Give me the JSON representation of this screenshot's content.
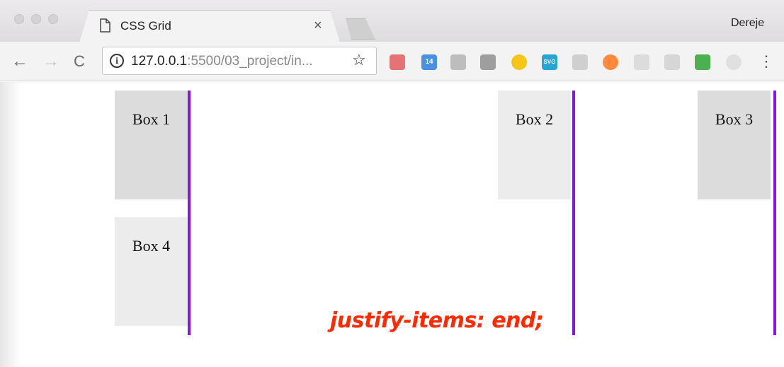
{
  "window": {
    "tab_title": "CSS Grid",
    "tab_close": "×",
    "profile_name": "Dereje"
  },
  "toolbar": {
    "back": "←",
    "forward": "→",
    "reload": "C",
    "url_host": "127.0.0.1",
    "url_rest": ":5500/03_project/in...",
    "bookmark_star": "☆",
    "menu": "⋮",
    "extensions": [
      {
        "name": "book-icon",
        "color": "#e57373"
      },
      {
        "name": "calendar-14-icon",
        "color": "#4a90e2",
        "label": "14"
      },
      {
        "name": "json-viewer-icon",
        "color": "#bdbdbd"
      },
      {
        "name": "braces-icon",
        "color": "#9e9e9e"
      },
      {
        "name": "moon-icon",
        "color": "#f5c518"
      },
      {
        "name": "svg-icon",
        "color": "#2aa4d5",
        "label": "SVG"
      },
      {
        "name": "pen-icon",
        "color": "#cfcfcf"
      },
      {
        "name": "lifebuoy-icon",
        "color": "#ff8a3d"
      },
      {
        "name": "leaf-icon",
        "color": "#dcdcdc"
      },
      {
        "name": "react-icon",
        "color": "#d6d6d6"
      },
      {
        "name": "classroom-icon",
        "color": "#4caf50"
      },
      {
        "name": "target-icon",
        "color": "#e0e0e0"
      }
    ]
  },
  "page": {
    "boxes": [
      "Box 1",
      "Box 2",
      "Box 3",
      "Box 4"
    ],
    "caption": "justify-items: end;",
    "grid_line_color": "#8a12f0",
    "caption_color": "#ff2a00"
  }
}
